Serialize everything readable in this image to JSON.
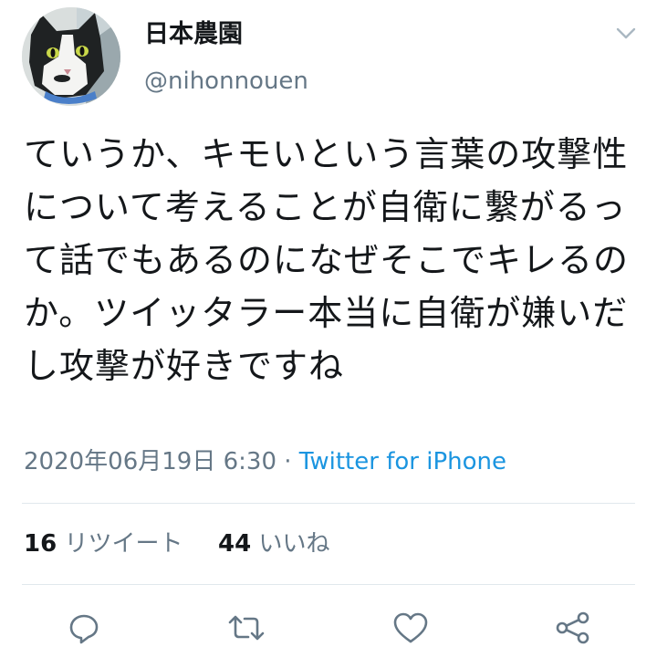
{
  "user": {
    "display_name": "日本農園",
    "handle": "@nihonnouen"
  },
  "tweet": {
    "text": "ていうか、キモいという言葉の攻撃性について考えることが自衛に繫がるって話でもあるのになぜそこでキレるのか。ツイッタラー本当に自衛が嫌いだし攻撃が好きですね",
    "timestamp": "2020年06月19日 6:30",
    "separator": "·",
    "source": "Twitter for iPhone"
  },
  "stats": {
    "retweets_count": "16",
    "retweets_label": "リツイート",
    "likes_count": "44",
    "likes_label": "いいね"
  },
  "colors": {
    "text": "#14171a",
    "secondary": "#657786",
    "link": "#1b95e0",
    "divider": "#e1e8ed"
  },
  "icons": {
    "menu": "chevron-down-icon",
    "reply": "reply-icon",
    "retweet": "retweet-icon",
    "like": "heart-icon",
    "share": "share-icon"
  }
}
